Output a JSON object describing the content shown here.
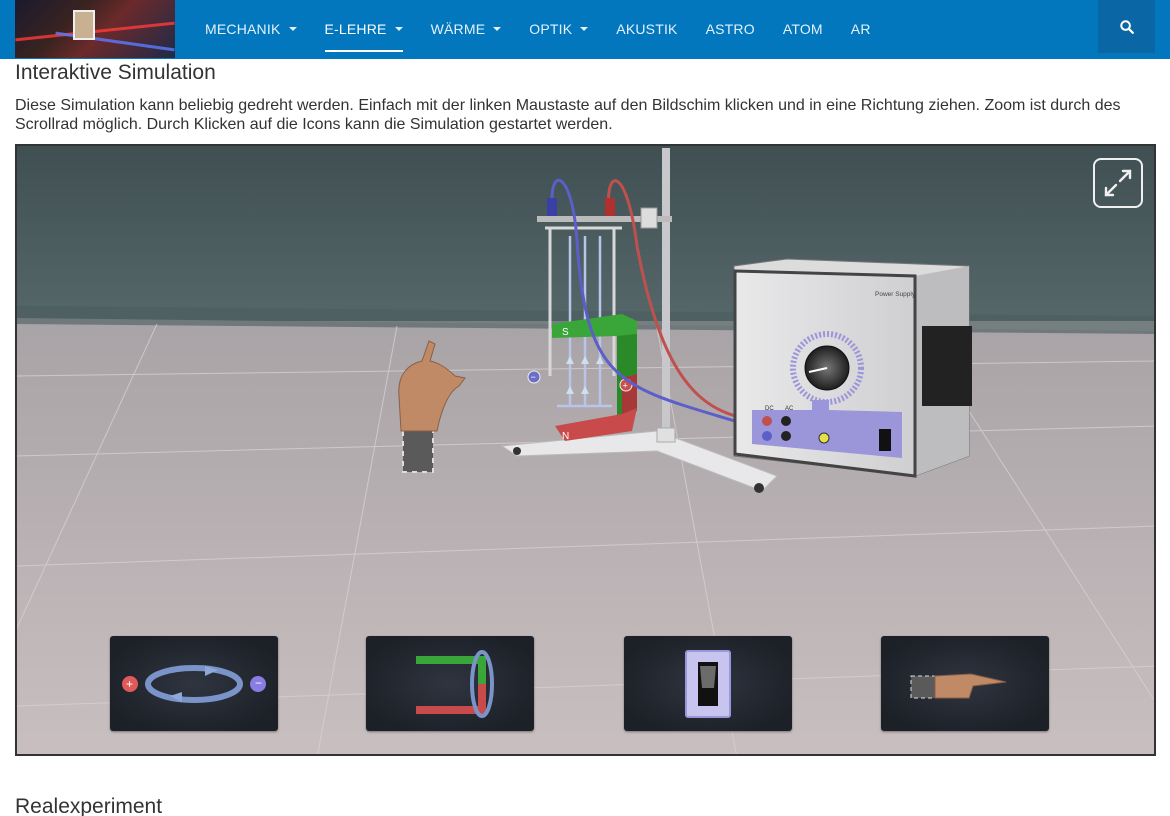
{
  "nav": {
    "items": [
      {
        "label": "MECHANIK",
        "dropdown": true,
        "active": false
      },
      {
        "label": "E-LEHRE",
        "dropdown": true,
        "active": true
      },
      {
        "label": "WÄRME",
        "dropdown": true,
        "active": false
      },
      {
        "label": "OPTIK",
        "dropdown": true,
        "active": false
      },
      {
        "label": "AKUSTIK",
        "dropdown": false,
        "active": false
      },
      {
        "label": "ASTRO",
        "dropdown": false,
        "active": false
      },
      {
        "label": "ATOM",
        "dropdown": false,
        "active": false
      },
      {
        "label": "AR",
        "dropdown": false,
        "active": false
      }
    ],
    "search_icon": "search-icon",
    "logo_icon": "experiment-photo-logo"
  },
  "content": {
    "section_title": "Interaktive Simulation",
    "intro_text": "Diese Simulation kann beliebig gedreht werden. Einfach mit der linken Maustaste auf den Bildschim klicken und in eine Richtung ziehen. Zoom ist durch des Scrollrad möglich. Durch Klicken auf die Icons kann die Simulation gestartet werden.",
    "next_section_title": "Realexperiment"
  },
  "simulation": {
    "magnet_labels": {
      "north": "N",
      "south": "S"
    },
    "power_supply_label": "Power Supply",
    "socket_labels": {
      "dc": "DC",
      "ac": "AC"
    },
    "controls": [
      {
        "name": "polarity-control",
        "icon": "polarity-swap-icon"
      },
      {
        "name": "magnet-rotate-control",
        "icon": "magnet-rotate-icon"
      },
      {
        "name": "power-switch-control",
        "icon": "power-switch-icon"
      },
      {
        "name": "hand-rule-control",
        "icon": "hand-rule-icon"
      }
    ],
    "fullscreen_icon": "fullscreen-icon"
  },
  "colors": {
    "navbar": "#0277bd",
    "nav_search_bg": "#0a66a4",
    "wall": "#47585a",
    "floor": "#b9b3b5",
    "magnet_green": "#3aa63a",
    "magnet_red": "#c94a4a",
    "wire_red": "#c0504d",
    "wire_blue": "#5b5fc7",
    "panel_purple": "#9b95d9"
  }
}
